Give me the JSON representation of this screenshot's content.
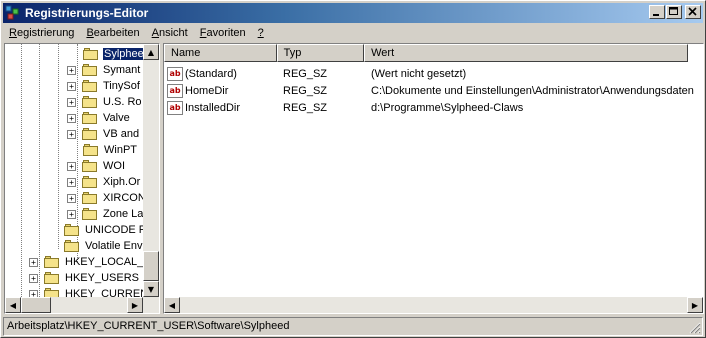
{
  "window": {
    "title": "Registrierungs-Editor",
    "minimize": "_",
    "maximize": "□",
    "close": "✕"
  },
  "menu": [
    {
      "key": "R",
      "rest": "egistrierung"
    },
    {
      "key": "B",
      "rest": "earbeiten"
    },
    {
      "key": "A",
      "rest": "nsicht"
    },
    {
      "key": "F",
      "rest": "avoriten"
    },
    {
      "key": "?",
      "rest": ""
    }
  ],
  "tree": {
    "items": [
      {
        "label": "Sylphee",
        "expander": "",
        "selected": true
      },
      {
        "label": "Symant",
        "expander": "+"
      },
      {
        "label": "TinySof",
        "expander": "+"
      },
      {
        "label": "U.S. Ro",
        "expander": "+"
      },
      {
        "label": "Valve",
        "expander": "+"
      },
      {
        "label": "VB and",
        "expander": "+"
      },
      {
        "label": "WinPT",
        "expander": ""
      },
      {
        "label": "WOI",
        "expander": "+"
      },
      {
        "label": "Xiph.Or",
        "expander": "+"
      },
      {
        "label": "XIRCON",
        "expander": "+"
      },
      {
        "label": "Zone La",
        "expander": "+"
      },
      {
        "label": "UNICODE P",
        "expander": ""
      },
      {
        "label": "Volatile Env",
        "expander": ""
      },
      {
        "label": "HKEY_LOCAL_M",
        "expander": "+"
      },
      {
        "label": "HKEY_USERS",
        "expander": "+"
      },
      {
        "label": "HKEY_CURRENT",
        "expander": "+"
      }
    ]
  },
  "list": {
    "columns": [
      "Name",
      "Typ",
      "Wert"
    ],
    "rows": [
      {
        "name": "(Standard)",
        "type": "REG_SZ",
        "value": "(Wert nicht gesetzt)"
      },
      {
        "name": "HomeDir",
        "type": "REG_SZ",
        "value": "C:\\Dokumente und Einstellungen\\Administrator\\Anwendungsdaten"
      },
      {
        "name": "InstalledDir",
        "type": "REG_SZ",
        "value": "d:\\Programme\\Sylpheed-Claws"
      }
    ],
    "icon_text": "ab"
  },
  "status": {
    "path": "Arbeitsplatz\\HKEY_CURRENT_USER\\Software\\Sylpheed"
  },
  "scroll": {
    "up": "▲",
    "down": "▼",
    "left": "◀",
    "right": "▶"
  }
}
